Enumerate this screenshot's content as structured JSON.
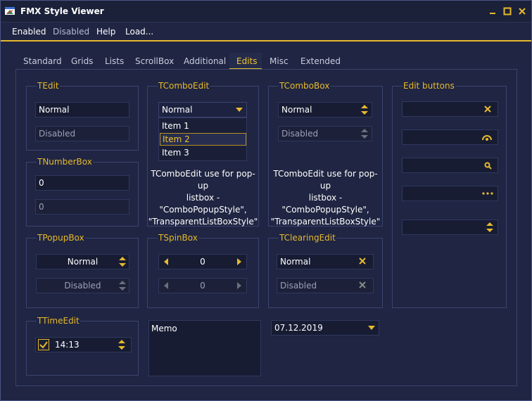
{
  "window": {
    "title": "FMX Style Viewer"
  },
  "menu": {
    "enabled": "Enabled",
    "disabled": "Disabled",
    "help": "Help",
    "load": "Load..."
  },
  "tabs": [
    {
      "label": "Standard"
    },
    {
      "label": "Grids"
    },
    {
      "label": "Lists"
    },
    {
      "label": "ScrollBox"
    },
    {
      "label": "Additional"
    },
    {
      "label": "Edits"
    },
    {
      "label": "Misc"
    },
    {
      "label": "Extended"
    }
  ],
  "active_tab": "Edits",
  "tedit": {
    "title": "TEdit",
    "normal": "Normal",
    "disabled": "Disabled"
  },
  "tnumberbox": {
    "title": "TNumberBox",
    "value": "0",
    "disabled_value": "0"
  },
  "tcomboedit": {
    "title": "TComboEdit",
    "value": "Normal",
    "items": [
      "Item 1",
      "Item 2",
      "Item 3"
    ],
    "selected_item": "Item 2",
    "note": [
      "TComboEdit use for pop-up",
      "listbox -",
      "\"ComboPopupStyle\",",
      "\"TransparentListBoxStyle\""
    ]
  },
  "tcombobox": {
    "title": "TComboBox",
    "value": "Normal",
    "disabled": "Disabled",
    "note": [
      "TComboEdit use for pop-up",
      "listbox -",
      "\"ComboPopupStyle\",",
      "\"TransparentListBoxStyle\""
    ]
  },
  "editbuttons": {
    "title": "Edit buttons"
  },
  "tpopupbox": {
    "title": "TPopupBox",
    "value": "Normal",
    "disabled": "Disabled"
  },
  "tspinbox": {
    "title": "TSpinBox",
    "value": "0",
    "disabled_value": "0"
  },
  "tclearingedit": {
    "title": "TClearingEdit",
    "value": "Normal",
    "disabled": "Disabled"
  },
  "ttimeedit": {
    "title": "TTimeEdit",
    "value": "14:13",
    "checked": true
  },
  "memo": {
    "text": "Memo"
  },
  "dateedit": {
    "value": "07.12.2019"
  },
  "colors": {
    "accent": "#e7b92d",
    "background": "#1f2542",
    "field": "#171c33"
  }
}
